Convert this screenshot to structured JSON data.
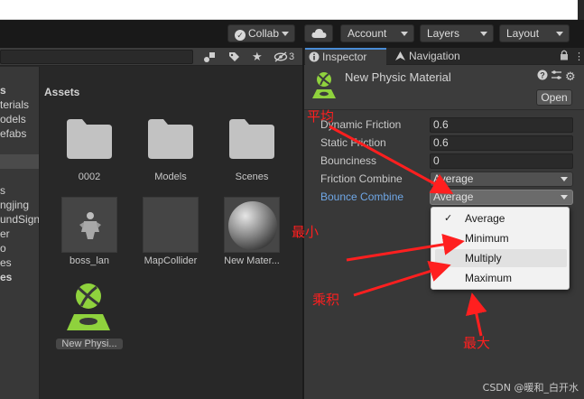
{
  "toolbar": {
    "collab_label": "Collab",
    "account_label": "Account",
    "layers_label": "Layers",
    "layout_label": "Layout"
  },
  "project": {
    "filter_count": "3",
    "tree_items": [
      "s",
      "terials",
      "odels",
      "efabs",
      "s",
      "ngjing",
      "undSign",
      "er",
      "o",
      "es",
      "es"
    ],
    "assets_title": "Assets",
    "assets": [
      {
        "name": "0002",
        "kind": "folder"
      },
      {
        "name": "Models",
        "kind": "folder"
      },
      {
        "name": "Scenes",
        "kind": "folder"
      },
      {
        "name": "boss_lan",
        "kind": "model"
      },
      {
        "name": "MapCollider",
        "kind": "asset"
      },
      {
        "name": "New Mater...",
        "kind": "material"
      },
      {
        "name": "New Physi...",
        "kind": "physic-material"
      }
    ]
  },
  "inspector": {
    "tab_inspector": "Inspector",
    "tab_navigation": "Navigation",
    "asset_title": "New Physic Material",
    "open_label": "Open",
    "properties": [
      {
        "label": "Dynamic Friction",
        "value": "0.6",
        "type": "number"
      },
      {
        "label": "Static Friction",
        "value": "0.6",
        "type": "number"
      },
      {
        "label": "Bounciness",
        "value": "0",
        "type": "number"
      },
      {
        "label": "Friction Combine",
        "value": "Average",
        "type": "enum"
      },
      {
        "label": "Bounce Combine",
        "value": "Average",
        "type": "enum"
      }
    ],
    "popup": {
      "options": [
        "Average",
        "Minimum",
        "Multiply",
        "Maximum"
      ],
      "selected": "Average",
      "hovered": "Multiply"
    }
  },
  "annotations": {
    "average": "平均",
    "minimum": "最小",
    "multiply": "乘积",
    "maximum": "最大"
  },
  "watermark": "CSDN @暖和_白开水",
  "colors": {
    "accent_label": "#6fa7e6",
    "annotation_red": "#ff1f1f",
    "physic_icon_green": "#8fd23d",
    "tab_accent": "#4a8cd6"
  }
}
